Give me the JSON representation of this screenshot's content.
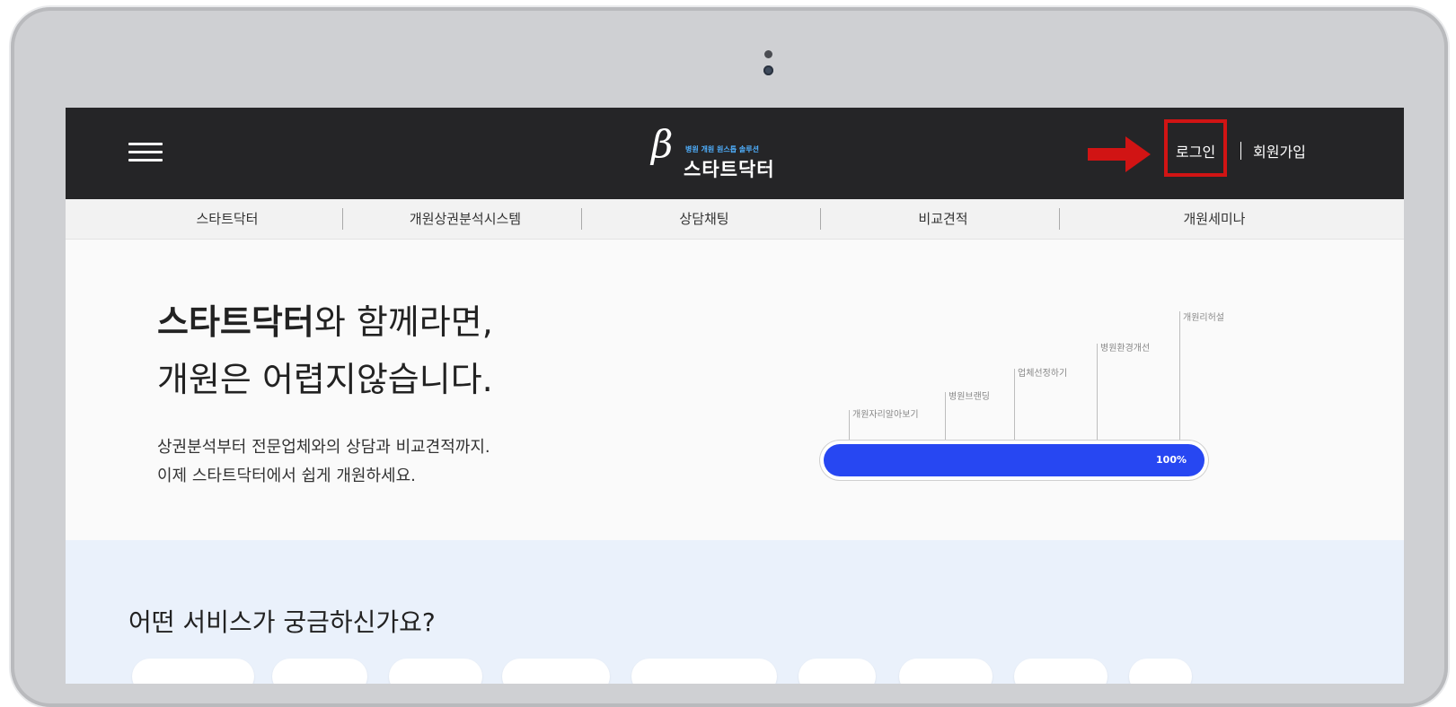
{
  "header": {
    "logo": {
      "symbol": "β",
      "slogan": "병원 개원 원스톱 솔루션",
      "name": "스타트닥터"
    },
    "login_label": "로그인",
    "separator": "|",
    "signup_label": "회원가입",
    "highlight_color": "#d11414"
  },
  "subnav": {
    "items": [
      {
        "label": "스타트닥터"
      },
      {
        "label": "개원상권분석시스템"
      },
      {
        "label": "상담채팅"
      },
      {
        "label": "비교견적"
      },
      {
        "label": "개원세미나"
      }
    ]
  },
  "hero": {
    "title_strong": "스타트닥터",
    "title_rest": "와 함께라면,",
    "title_line2": "개원은 어렵지않습니다.",
    "desc_line1": "상권분석부터 전문업체와의 상담과 비교견적까지.",
    "desc_line2": "이제 스타트닥터에서 쉽게 개원하세요."
  },
  "progress": {
    "steps": [
      "개원자리알아보기",
      "병원브랜딩",
      "업체선정하기",
      "병원환경개선",
      "개원리허설"
    ],
    "value_fraction": 1.0,
    "value_label": "100%",
    "fill_color": "#2747f2"
  },
  "services": {
    "title": "어떤 서비스가 궁금하신가요?"
  }
}
